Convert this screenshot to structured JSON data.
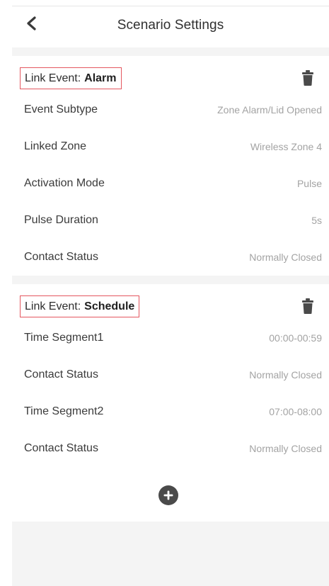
{
  "header": {
    "title": "Scenario Settings",
    "back_icon": "chevron-left-icon"
  },
  "events": [
    {
      "prefix": "Link Event:",
      "value": "Alarm",
      "rows": [
        {
          "label": "Event Subtype",
          "value": "Zone Alarm/Lid Opened"
        },
        {
          "label": "Linked Zone",
          "value": "Wireless Zone 4"
        },
        {
          "label": "Activation Mode",
          "value": "Pulse"
        },
        {
          "label": "Pulse Duration",
          "value": "5s"
        },
        {
          "label": "Contact Status",
          "value": "Normally Closed"
        }
      ]
    },
    {
      "prefix": "Link Event:",
      "value": "Schedule",
      "rows": [
        {
          "label": "Time Segment1",
          "value": "00:00-00:59"
        },
        {
          "label": "Contact Status",
          "value": "Normally Closed"
        },
        {
          "label": "Time Segment2",
          "value": "07:00-08:00"
        },
        {
          "label": "Contact Status",
          "value": "Normally Closed"
        }
      ]
    }
  ],
  "icons": {
    "delete": "trash-icon",
    "add": "plus-circle-icon"
  },
  "colors": {
    "highlight_border": "#e4575f",
    "background_gray": "#f4f4f4",
    "value_text": "#a3a3a3"
  }
}
